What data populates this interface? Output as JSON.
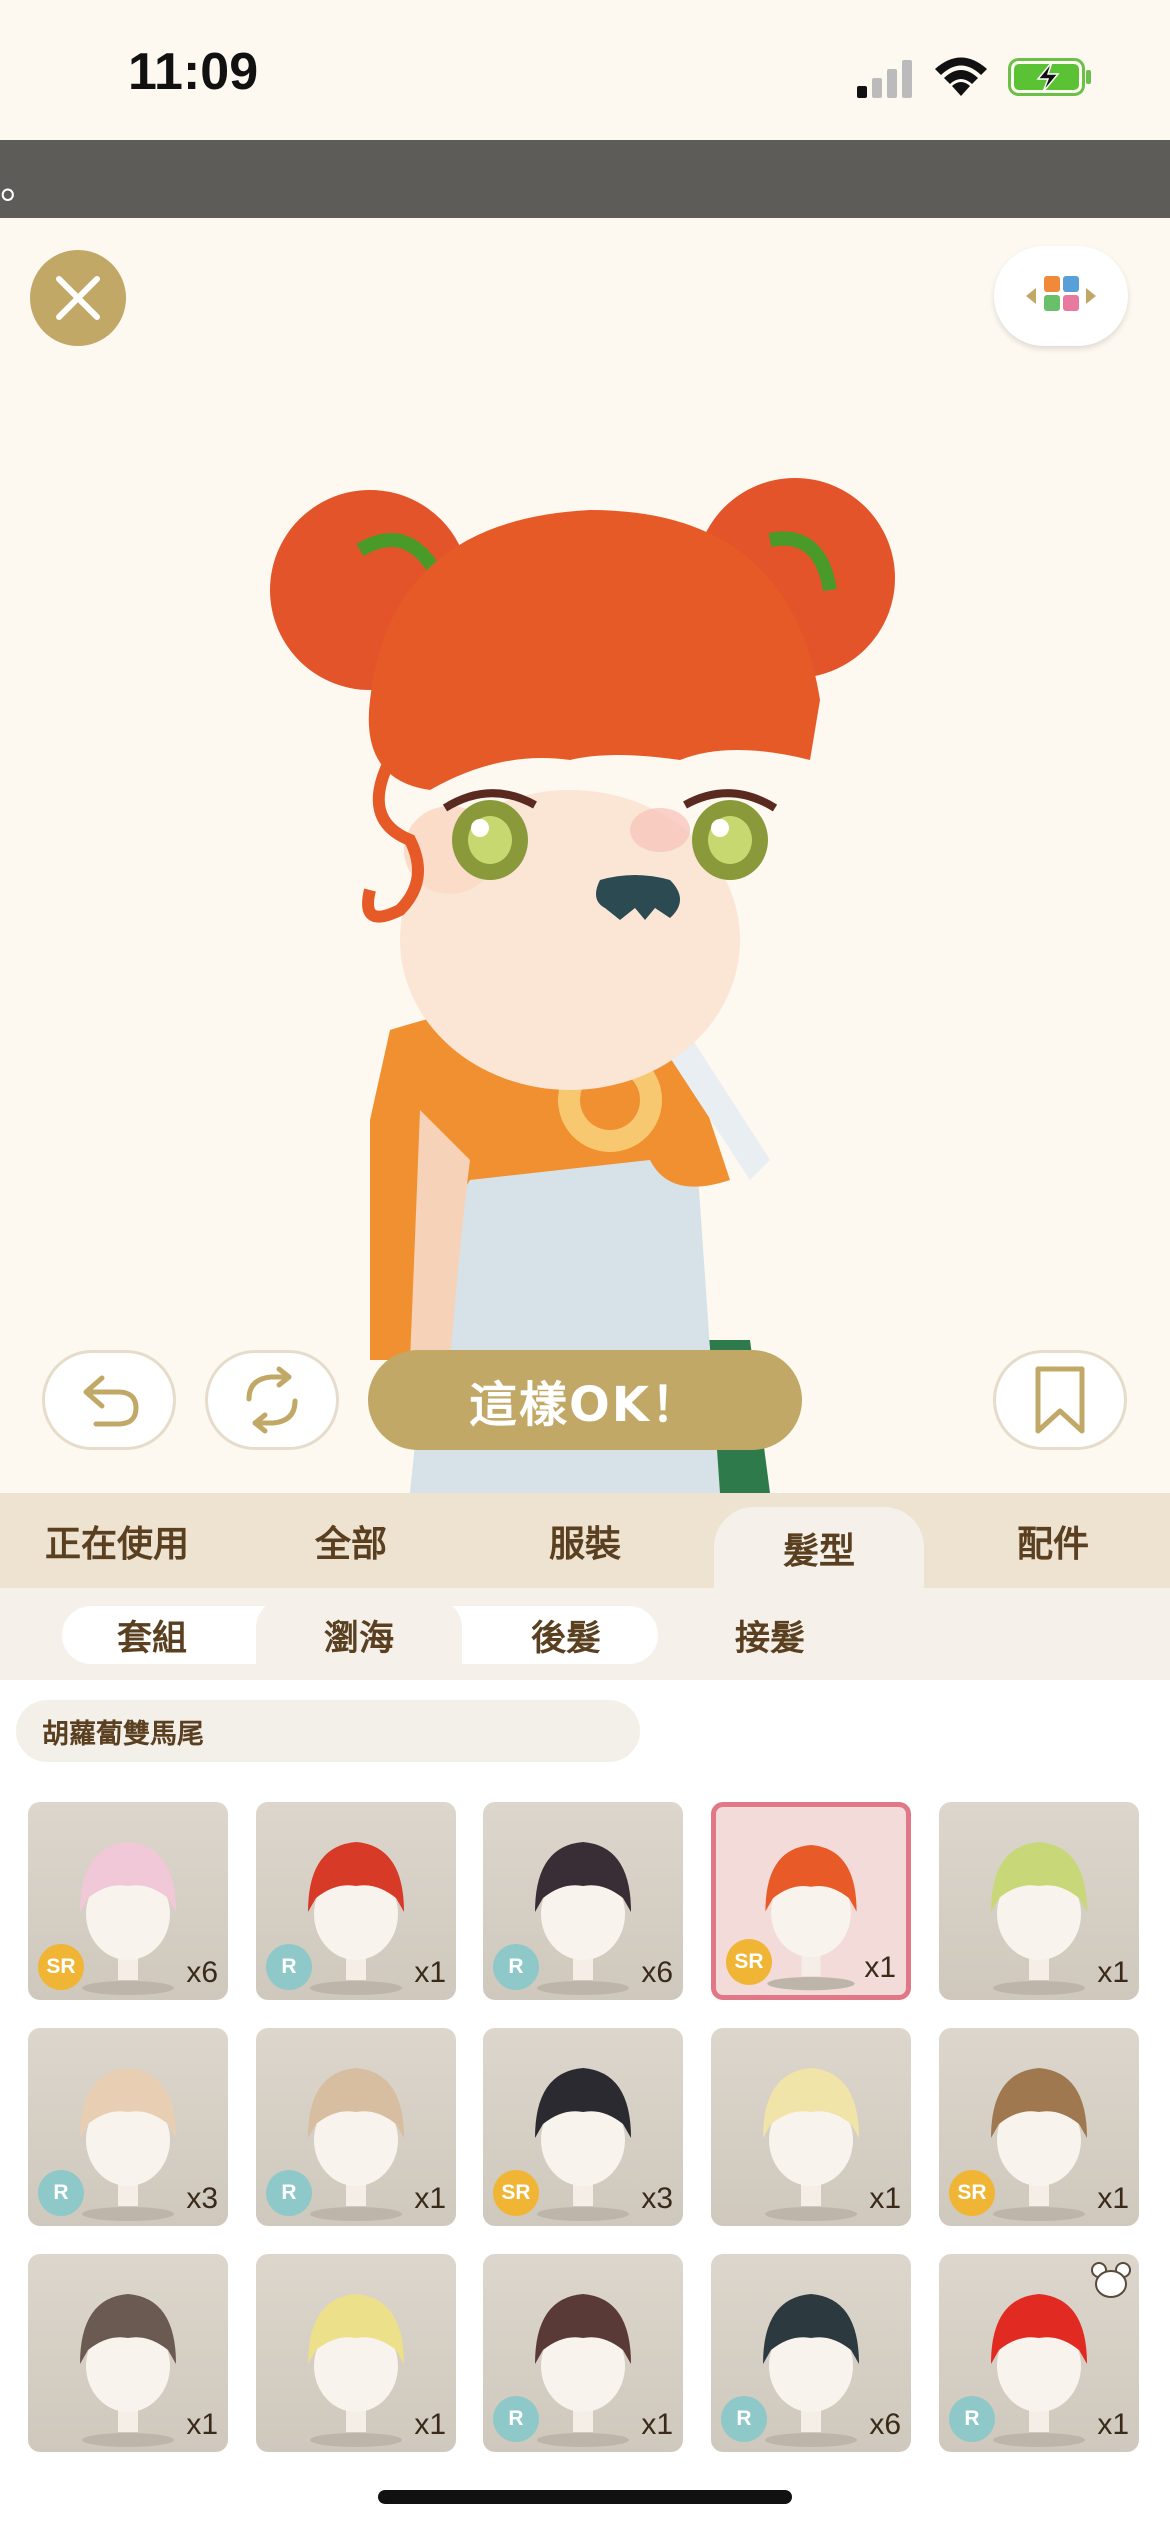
{
  "status_bar": {
    "time": "11:09"
  },
  "banner": {
    "text": "。"
  },
  "stage": {
    "close_icon": "close-icon",
    "layout_icon": "grid-toggle-icon",
    "undo_icon": "undo-icon",
    "random_icon": "shuffle-icon",
    "ok_label": "這樣OK！",
    "bookmark_icon": "bookmark-icon"
  },
  "category_tabs": [
    {
      "label": "正在使用",
      "active": false
    },
    {
      "label": "全部",
      "active": false
    },
    {
      "label": "服裝",
      "active": false
    },
    {
      "label": "髮型",
      "active": true
    },
    {
      "label": "配件",
      "active": false
    }
  ],
  "sub_tabs": [
    {
      "label": "套組",
      "active": false
    },
    {
      "label": "瀏海",
      "active": true
    },
    {
      "label": "後髮",
      "active": false
    },
    {
      "label": "接髮",
      "active": false
    }
  ],
  "selected_item_name": "胡蘿蔔雙馬尾",
  "items": [
    {
      "rarity": "SR",
      "count": "x6",
      "hair_color": "#f0c8d8",
      "selected": false
    },
    {
      "rarity": "R",
      "count": "x1",
      "hair_color": "#d83a28",
      "selected": false
    },
    {
      "rarity": "R",
      "count": "x6",
      "hair_color": "#3a2e36",
      "selected": false
    },
    {
      "rarity": "SR",
      "count": "x1",
      "hair_color": "#e85a28",
      "selected": true
    },
    {
      "rarity": "",
      "count": "x1",
      "hair_color": "#c8d878",
      "selected": false
    },
    {
      "rarity": "R",
      "count": "x3",
      "hair_color": "#e8cfb4",
      "selected": false
    },
    {
      "rarity": "R",
      "count": "x1",
      "hair_color": "#d8bea0",
      "selected": false
    },
    {
      "rarity": "SR",
      "count": "x3",
      "hair_color": "#2a2a30",
      "selected": false
    },
    {
      "rarity": "",
      "count": "x1",
      "hair_color": "#f0e4a8",
      "selected": false
    },
    {
      "rarity": "SR",
      "count": "x1",
      "hair_color": "#a07850",
      "selected": false
    },
    {
      "rarity": "",
      "count": "x1",
      "hair_color": "#6a5a52",
      "selected": false
    },
    {
      "rarity": "",
      "count": "x1",
      "hair_color": "#ece08a",
      "selected": false
    },
    {
      "rarity": "R",
      "count": "x1",
      "hair_color": "#5a3a36",
      "selected": false
    },
    {
      "rarity": "R",
      "count": "x6",
      "hair_color": "#2c3a40",
      "selected": false
    },
    {
      "rarity": "R",
      "count": "x1",
      "hair_color": "#e02a22",
      "selected": false
    }
  ],
  "colors": {
    "accent_gold": "#c2a866",
    "selected_border": "#e07888",
    "sr_badge": "#f0b535",
    "r_badge": "#8ec8c8"
  }
}
